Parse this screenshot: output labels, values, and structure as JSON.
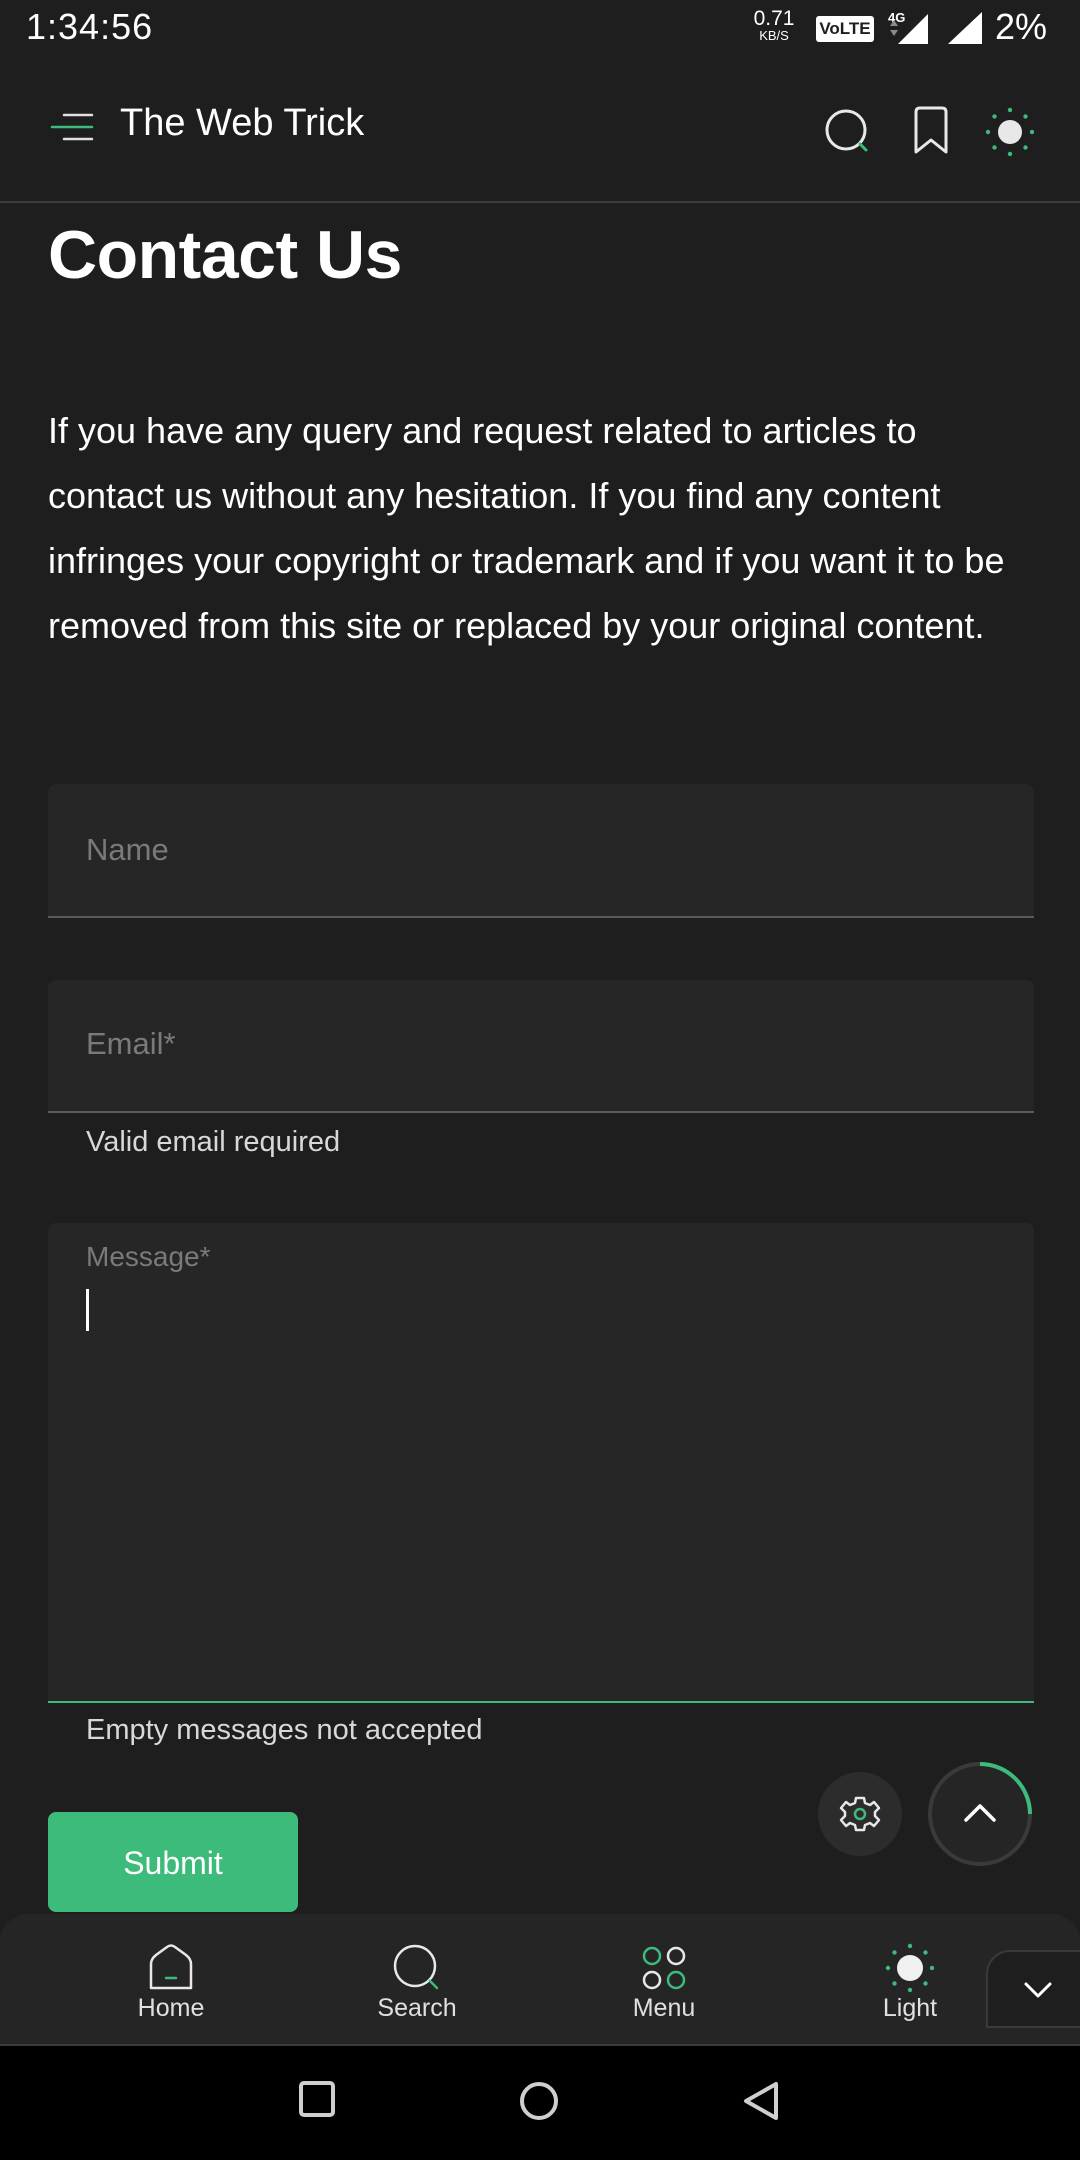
{
  "status_bar": {
    "time": "1:34:56",
    "net_speed_value": "0.71",
    "net_speed_unit": "KB/S",
    "volte": "VoLTE",
    "network": "4G",
    "battery": "2%"
  },
  "header": {
    "title": "The Web Trick",
    "icons": [
      "menu-icon",
      "search-icon",
      "bookmark-icon",
      "sun-icon"
    ]
  },
  "page": {
    "title": "Contact Us",
    "intro": "If you have any query and request related to articles to contact us without any hesitation. If you find any content infringes your copyright or trademark and if you want it to be removed from this site or replaced by your original content."
  },
  "form": {
    "name_placeholder": "Name",
    "name_value": "",
    "email_placeholder": "Email*",
    "email_value": "",
    "email_hint": "Valid email required",
    "message_label": "Message*",
    "message_value": "",
    "message_hint": "Empty messages not accepted",
    "submit_label": "Submit"
  },
  "bottom_nav": {
    "items": [
      {
        "label": "Home",
        "icon": "home-icon"
      },
      {
        "label": "Search",
        "icon": "search-icon"
      },
      {
        "label": "Menu",
        "icon": "menu-grid-icon"
      },
      {
        "label": "Light",
        "icon": "sun-icon"
      }
    ]
  },
  "colors": {
    "background": "#1e1e1e",
    "accent": "#3dbb7a",
    "field_bg": "#262626",
    "nav_bg": "#252525"
  }
}
